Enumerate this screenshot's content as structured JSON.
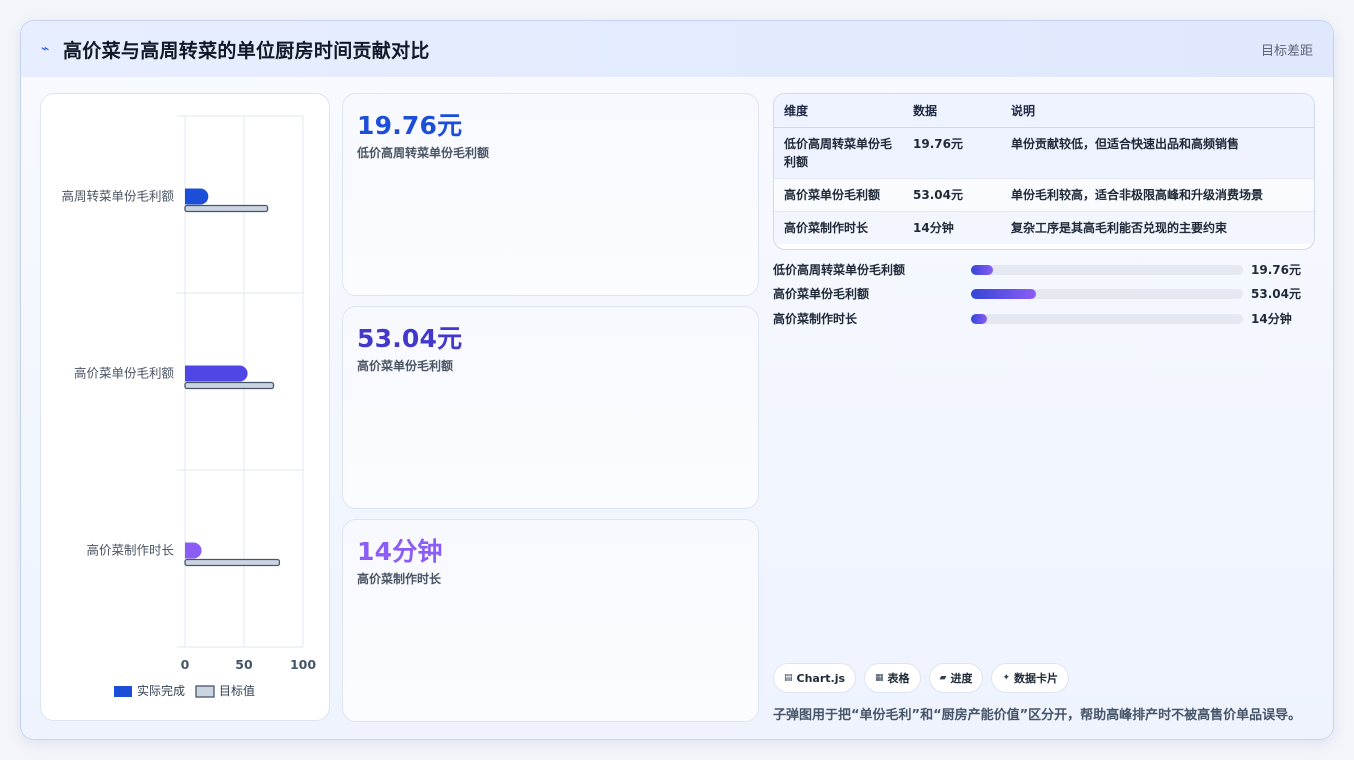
{
  "header": {
    "icon": "pulse-icon",
    "title": "高价菜与高周转菜的单位厨房时间贡献对比",
    "right_label": "目标差距"
  },
  "chart_data": {
    "type": "bar",
    "orientation": "horizontal",
    "categories": [
      "低价高周转菜单份毛利额",
      "高价菜单份毛利额",
      "高价菜制作时长"
    ],
    "category_labels_shown": [
      " 高周转菜单份毛利额",
      "高价菜单份毛利额",
      "高价菜制作时长"
    ],
    "series": [
      {
        "name": "实际完成",
        "values": [
          19.76,
          53.04,
          14
        ],
        "colors": [
          "#1d4ed8",
          "#4f46e5",
          "#8b5cf6"
        ]
      },
      {
        "name": "目标值",
        "values": [
          70,
          75,
          80
        ],
        "color": "#cbd5e1",
        "stroke": "#475569"
      }
    ],
    "xlim": [
      0,
      100
    ],
    "x_ticks": [
      "0",
      "50",
      "100"
    ],
    "legend_position": "bottom",
    "grid": true
  },
  "kpis": [
    {
      "value": "19.76元",
      "label": "低价高周转菜单份毛利额",
      "color": "#1d4ed8"
    },
    {
      "value": "53.04元",
      "label": "高价菜单份毛利额",
      "color": "#4338ca"
    },
    {
      "value": "14分钟",
      "label": "高价菜制作时长",
      "color": "#8b5cf6"
    }
  ],
  "table": {
    "headers": [
      "维度",
      "数据",
      "说明"
    ],
    "rows": [
      [
        "低价高周转菜单份毛利额",
        "19.76元",
        "单份贡献较低，但适合快速出品和高频销售"
      ],
      [
        "高价菜单份毛利额",
        "53.04元",
        "单份毛利较高，适合非极限高峰和升级消费场景"
      ],
      [
        "高价菜制作时长",
        "14分钟",
        "复杂工序是其高毛利能否兑现的主要约束"
      ]
    ]
  },
  "progress": [
    {
      "label": "低价高周转菜单份毛利额",
      "value": "19.76元",
      "fraction": 0.08
    },
    {
      "label": "高价菜单份毛利额",
      "value": "53.04元",
      "fraction": 0.24
    },
    {
      "label": "高价菜制作时长",
      "value": "14分钟",
      "fraction": 0.06
    }
  ],
  "chips": [
    {
      "icon": "chart-icon",
      "glyph": "▤",
      "label": "Chart.js"
    },
    {
      "icon": "table-icon",
      "glyph": "▦",
      "label": "表格"
    },
    {
      "icon": "progress-icon",
      "glyph": "▰",
      "label": "进度"
    },
    {
      "icon": "sparkle-icon",
      "glyph": "✦",
      "label": "数据卡片"
    }
  ],
  "note": "子弹图用于把“单份毛利”和“厨房产能价值”区分开，帮助高峰排产时不被高售价单品误导。"
}
